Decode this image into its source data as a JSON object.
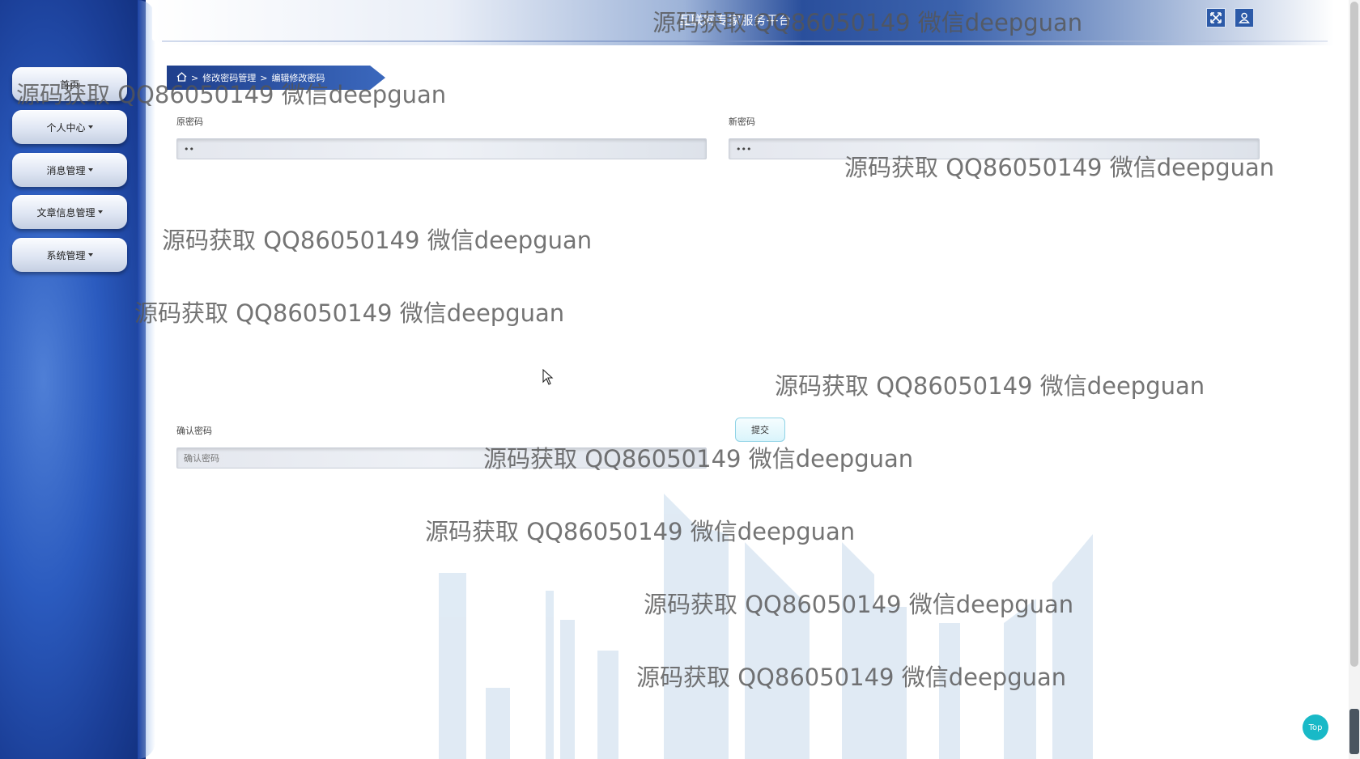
{
  "header": {
    "title": "互联网专家服务平台",
    "icons": [
      "fullscreen-icon",
      "user-icon"
    ]
  },
  "sidebar": {
    "items": [
      {
        "label": "首页"
      },
      {
        "label": "个人中心"
      },
      {
        "label": "消息管理"
      },
      {
        "label": "文章信息管理"
      },
      {
        "label": "系统管理"
      }
    ]
  },
  "breadcrumb": {
    "home_icon": "home-icon",
    "sep": ">",
    "items": [
      "修改密码管理",
      "编辑修改密码"
    ]
  },
  "form": {
    "old_password": {
      "label": "原密码",
      "value": "••"
    },
    "new_password": {
      "label": "新密码",
      "value": "•••"
    },
    "confirm_password": {
      "label": "确认密码",
      "placeholder": "确认密码"
    },
    "submit_label": "提交"
  },
  "top_button": {
    "label": "Top"
  },
  "watermark": "源码获取 QQ86050149 微信deepguan",
  "colors": {
    "sidebar": "#2b5bbf",
    "breadcrumb": "#1f3f8c",
    "top_button": "#19b9c7"
  }
}
